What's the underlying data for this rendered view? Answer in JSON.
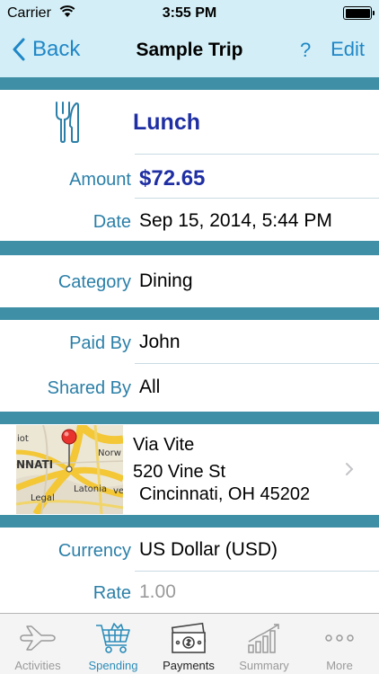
{
  "status_bar": {
    "carrier": "Carrier",
    "time": "3:55 PM"
  },
  "nav": {
    "back_label": "Back",
    "title": "Sample Trip",
    "help_label": "?",
    "edit_label": "Edit"
  },
  "expense": {
    "name": "Lunch",
    "icon": "fork-knife-icon"
  },
  "amount": {
    "label": "Amount",
    "value": "$72.65"
  },
  "date": {
    "label": "Date",
    "value": "Sep 15, 2014, 5:44 PM"
  },
  "category": {
    "label": "Category",
    "value": "Dining"
  },
  "paid_by": {
    "label": "Paid By",
    "value": "John"
  },
  "shared_by": {
    "label": "Shared By",
    "value": "All"
  },
  "location": {
    "name": "Via Vite",
    "address_line1": "520 Vine St",
    "address_line2": "Cincinnati, OH 45202",
    "map_labels": [
      "iot",
      "NNATI",
      "Norw",
      "Legal",
      "Latonia",
      "ve"
    ]
  },
  "currency": {
    "label": "Currency",
    "value": "US Dollar (USD)"
  },
  "rate": {
    "label": "Rate",
    "value": "1.00"
  },
  "tabs": [
    {
      "label": "Activities",
      "icon": "airplane-icon"
    },
    {
      "label": "Spending",
      "icon": "shopping-cart-icon"
    },
    {
      "label": "Payments",
      "icon": "money-icon"
    },
    {
      "label": "Summary",
      "icon": "bar-chart-icon"
    },
    {
      "label": "More",
      "icon": "more-dots-icon"
    }
  ],
  "active_tab": "Spending",
  "colors": {
    "accent": "#1f87c7",
    "label": "#2b7fa8",
    "section_band": "#3f8fa6",
    "header_bg": "#d3eef6",
    "lunch_title": "#1f2fa3"
  }
}
